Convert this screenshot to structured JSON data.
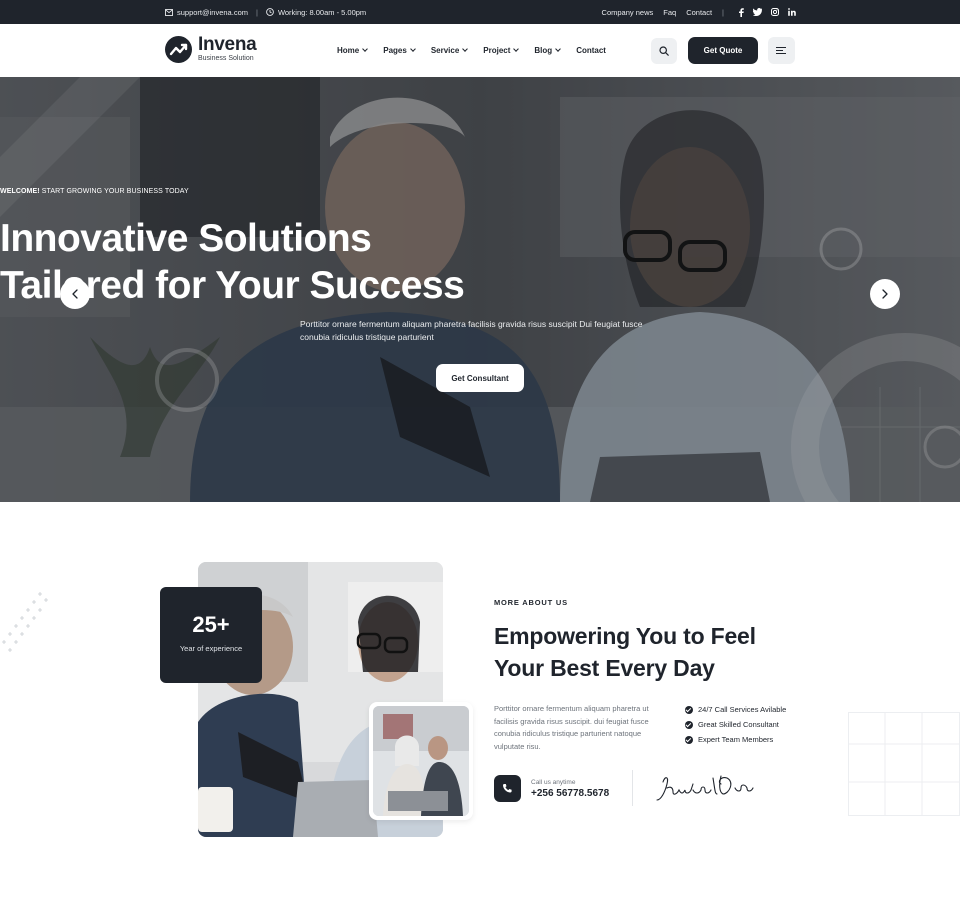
{
  "topbar": {
    "email": "support@invena.com",
    "hours": "Working: 8.00am - 5.00pm",
    "links": [
      "Company news",
      "Faq",
      "Contact"
    ],
    "social": [
      "f",
      "t",
      "ig",
      "in"
    ]
  },
  "header": {
    "logo_name": "Invena",
    "logo_tag": "Business Solution",
    "nav": [
      {
        "label": "Home",
        "has_dropdown": true
      },
      {
        "label": "Pages",
        "has_dropdown": true
      },
      {
        "label": "Service",
        "has_dropdown": true
      },
      {
        "label": "Project",
        "has_dropdown": true
      },
      {
        "label": "Blog",
        "has_dropdown": true
      },
      {
        "label": "Contact",
        "has_dropdown": false
      }
    ],
    "quote_label": "Get Quote"
  },
  "hero": {
    "eyebrow_bold": "WELCOME!",
    "eyebrow_rest": " START GROWING YOUR BUSINESS TODAY",
    "title_line1": "Innovative Solutions",
    "title_line2": "Tailored for Your Success",
    "subtitle": "Porttitor ornare fermentum aliquam pharetra facilisis gravida risus suscipit Dui feugiat fusce conubia ridiculus tristique parturient",
    "cta_label": "Get Consultant"
  },
  "about": {
    "experience_number": "25+",
    "experience_label": "Year of experience",
    "eyebrow": "MORE ABOUT US",
    "title_line1": "Empowering You to Feel",
    "title_line2": "Your Best Every Day",
    "text": "Porttitor ornare fermentum aliquam pharetra ut facilisis gravida risus suscipit. dui feugiat fusce conubia ridiculus tristique parturient natoque vulputate risu.",
    "features": [
      "24/7 Call Services Avilable",
      "Great Skilled Consultant",
      "Expert Team Members"
    ],
    "call_label": "Call us anytime",
    "call_number": "+256 56778.5678",
    "signature": "Jonathon Doe"
  },
  "colors": {
    "dark": "#1f242c",
    "light_button": "#eef0f2",
    "muted_text": "#6d737b"
  }
}
